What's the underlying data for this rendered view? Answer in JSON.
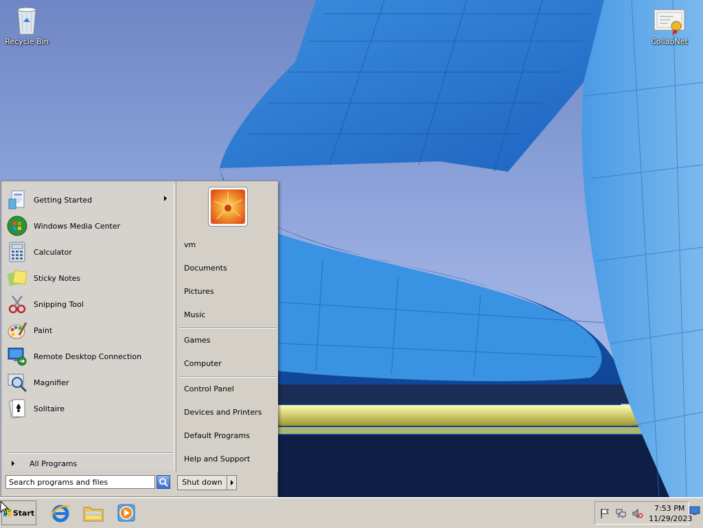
{
  "desktop": {
    "icons": [
      {
        "label": "Recycle Bin",
        "icon": "recycle-bin-icon"
      },
      {
        "label": "CollabNet",
        "icon": "certificate-icon"
      }
    ]
  },
  "start_menu": {
    "programs": [
      {
        "label": "Getting Started",
        "icon": "getting-started-icon",
        "has_submenu": true
      },
      {
        "label": "Windows Media Center",
        "icon": "media-center-icon"
      },
      {
        "label": "Calculator",
        "icon": "calculator-icon"
      },
      {
        "label": "Sticky Notes",
        "icon": "sticky-notes-icon"
      },
      {
        "label": "Snipping Tool",
        "icon": "snipping-tool-icon"
      },
      {
        "label": "Paint",
        "icon": "paint-icon"
      },
      {
        "label": "Remote Desktop Connection",
        "icon": "remote-desktop-icon"
      },
      {
        "label": "Magnifier",
        "icon": "magnifier-icon"
      },
      {
        "label": "Solitaire",
        "icon": "solitaire-icon"
      }
    ],
    "all_programs": "All Programs",
    "search_placeholder": "Search programs and files",
    "right_items": [
      {
        "label": "vm"
      },
      {
        "label": "Documents"
      },
      {
        "label": "Pictures"
      },
      {
        "label": "Music"
      },
      {
        "label": "Games"
      },
      {
        "label": "Computer"
      },
      {
        "label": "Control Panel"
      },
      {
        "label": "Devices and Printers"
      },
      {
        "label": "Default Programs"
      },
      {
        "label": "Help and Support"
      }
    ],
    "shutdown_label": "Shut down"
  },
  "taskbar": {
    "start_label": "Start",
    "pinned": [
      {
        "icon": "internet-explorer-icon"
      },
      {
        "icon": "file-explorer-icon"
      },
      {
        "icon": "media-player-icon"
      }
    ],
    "tray": {
      "time": "7:53 PM",
      "date": "11/29/2023",
      "icons": [
        "action-center-flag-icon",
        "network-icon",
        "volume-muted-icon"
      ]
    }
  },
  "colors": {
    "chrome": "#d4d0c8",
    "facade_blue": "#2f7fd6",
    "facade_dark": "#0d3f8f"
  }
}
